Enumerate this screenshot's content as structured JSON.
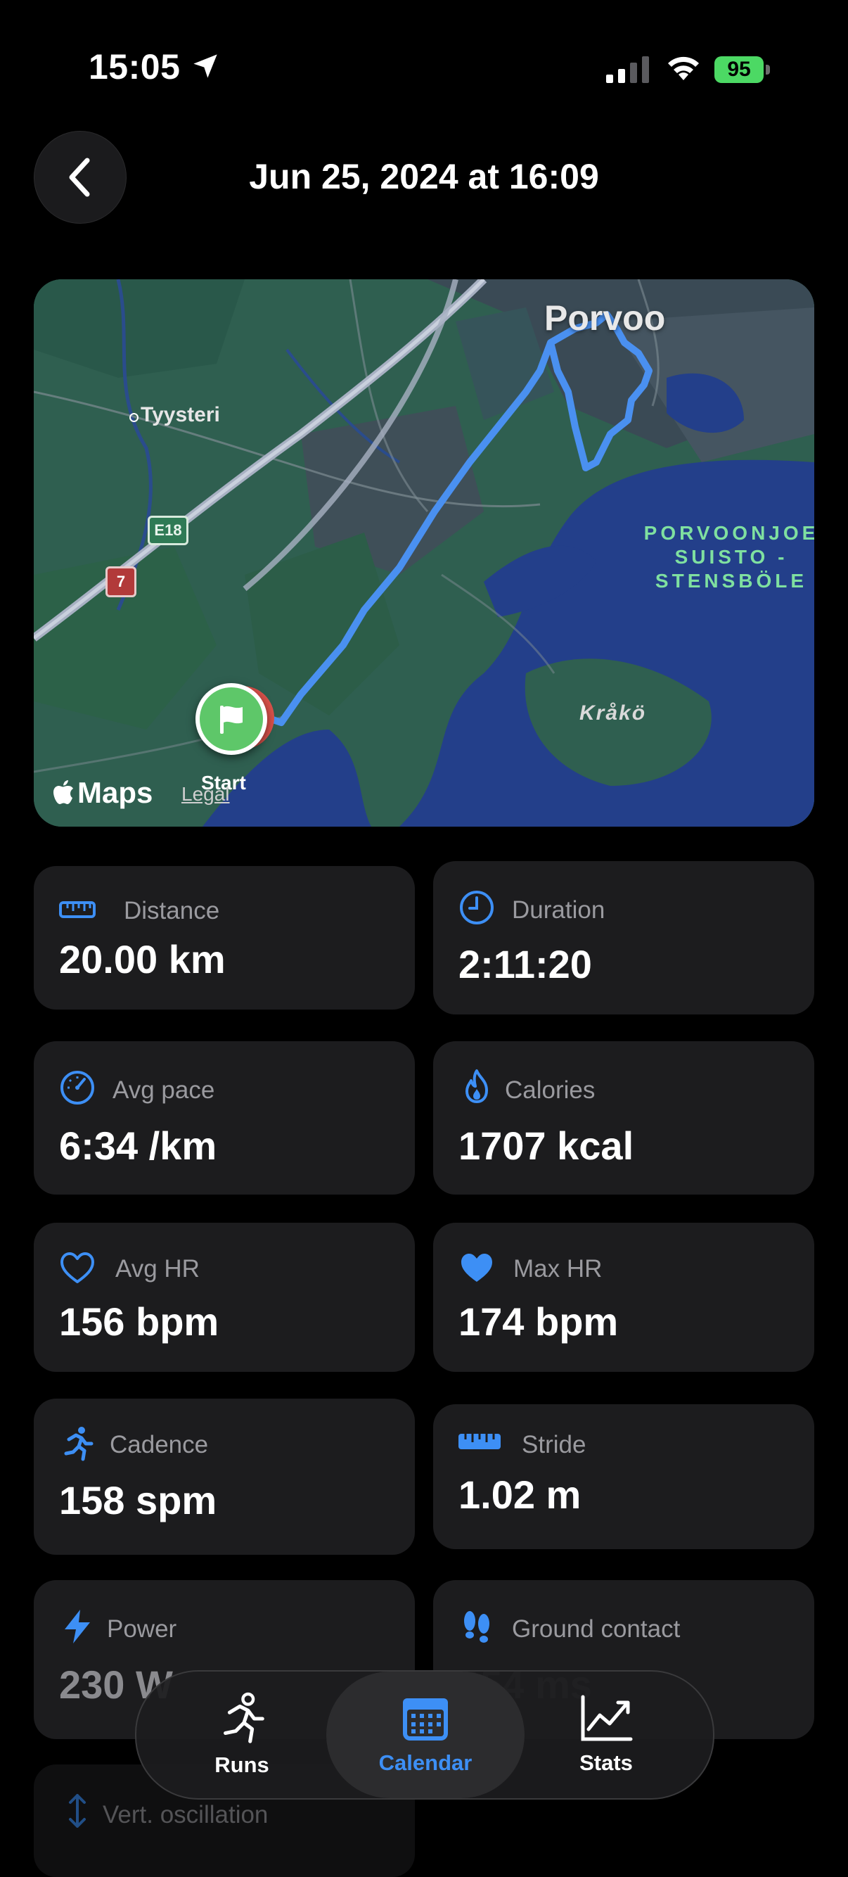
{
  "status_bar": {
    "time": "15:05",
    "battery": "95"
  },
  "header": {
    "title": "Jun 25, 2024 at 16:09"
  },
  "map": {
    "city_label": "Porvoo",
    "village_label": "Tyysteri",
    "park_label_line1": "PORVOONJOE",
    "park_label_line2": "SUISTO -",
    "park_label_line3": "STENSBÖLE",
    "island_label": "Kråkö",
    "road_e18": "E18",
    "road_7": "7",
    "start_label": "Start",
    "maps_brand": "Maps",
    "legal_label": "Legal"
  },
  "stats": [
    {
      "label": "Distance",
      "value": "20.00 km",
      "icon": "ruler-icon"
    },
    {
      "label": "Duration",
      "value": "2:11:20",
      "icon": "clock-icon"
    },
    {
      "label": "Avg pace",
      "value": "6:34 /km",
      "icon": "speedometer-icon"
    },
    {
      "label": "Calories",
      "value": "1707 kcal",
      "icon": "flame-icon"
    },
    {
      "label": "Avg HR",
      "value": "156 bpm",
      "icon": "heart-outline-icon"
    },
    {
      "label": "Max HR",
      "value": "174 bpm",
      "icon": "heart-filled-icon"
    },
    {
      "label": "Cadence",
      "value": "158 spm",
      "icon": "runner-icon"
    },
    {
      "label": "Stride",
      "value": "1.02 m",
      "icon": "ruler-icon"
    },
    {
      "label": "Power",
      "value": "230 W",
      "icon": "bolt-icon"
    },
    {
      "label": "Ground contact",
      "value": "254 ms",
      "icon": "footprints-icon"
    },
    {
      "label": "Vert. oscillation",
      "icon": "vertical-arrows-icon"
    }
  ],
  "tabs": [
    {
      "label": "Runs",
      "icon": "runner-icon"
    },
    {
      "label": "Calendar",
      "icon": "calendar-icon",
      "active": true
    },
    {
      "label": "Stats",
      "icon": "chart-icon"
    }
  ],
  "colors": {
    "accent": "#3d8ff5",
    "card": "#1c1c1e",
    "background": "#000000",
    "route": "#4a90f0"
  }
}
